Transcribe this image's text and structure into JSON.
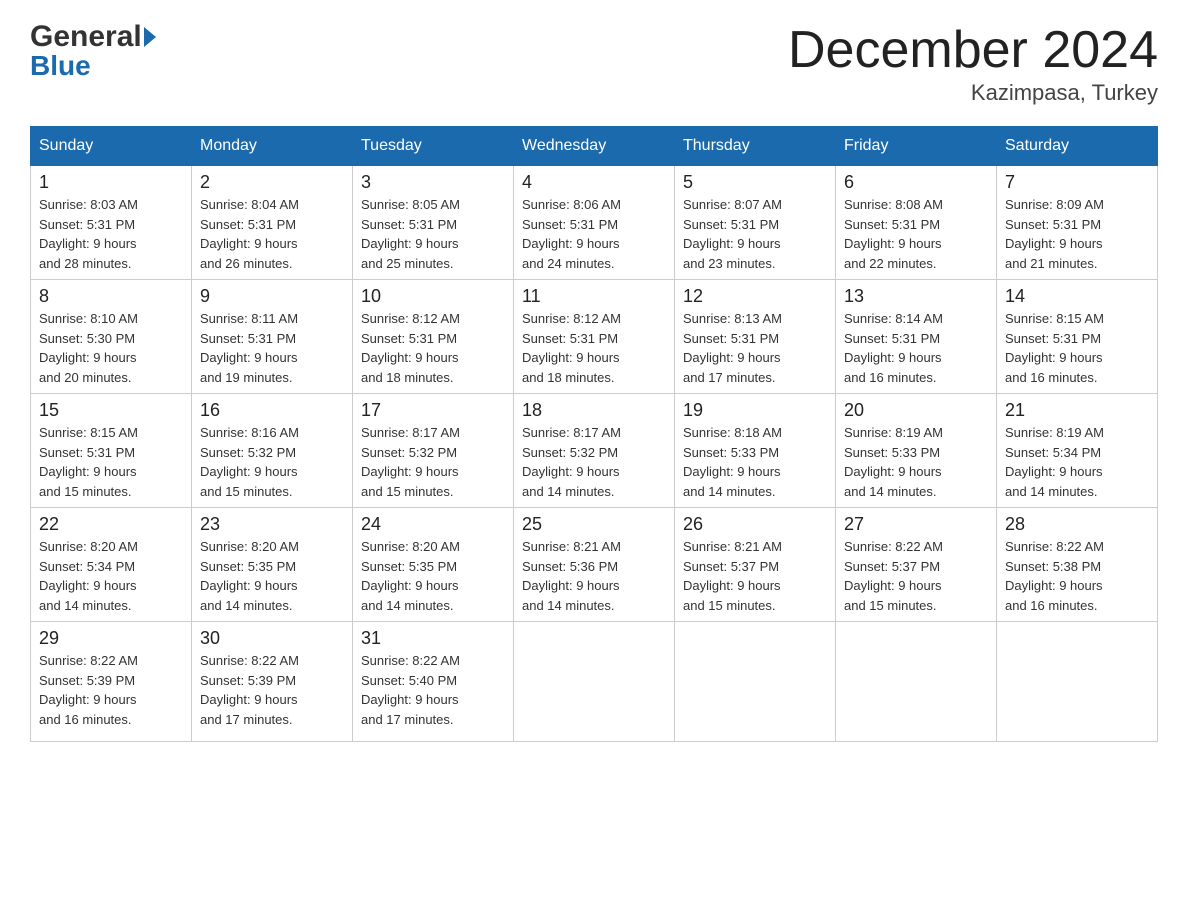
{
  "header": {
    "title": "December 2024",
    "subtitle": "Kazimpasa, Turkey",
    "logo_general": "General",
    "logo_blue": "Blue"
  },
  "days_of_week": [
    "Sunday",
    "Monday",
    "Tuesday",
    "Wednesday",
    "Thursday",
    "Friday",
    "Saturday"
  ],
  "weeks": [
    [
      {
        "day": "1",
        "sunrise": "8:03 AM",
        "sunset": "5:31 PM",
        "daylight": "9 hours and 28 minutes."
      },
      {
        "day": "2",
        "sunrise": "8:04 AM",
        "sunset": "5:31 PM",
        "daylight": "9 hours and 26 minutes."
      },
      {
        "day": "3",
        "sunrise": "8:05 AM",
        "sunset": "5:31 PM",
        "daylight": "9 hours and 25 minutes."
      },
      {
        "day": "4",
        "sunrise": "8:06 AM",
        "sunset": "5:31 PM",
        "daylight": "9 hours and 24 minutes."
      },
      {
        "day": "5",
        "sunrise": "8:07 AM",
        "sunset": "5:31 PM",
        "daylight": "9 hours and 23 minutes."
      },
      {
        "day": "6",
        "sunrise": "8:08 AM",
        "sunset": "5:31 PM",
        "daylight": "9 hours and 22 minutes."
      },
      {
        "day": "7",
        "sunrise": "8:09 AM",
        "sunset": "5:31 PM",
        "daylight": "9 hours and 21 minutes."
      }
    ],
    [
      {
        "day": "8",
        "sunrise": "8:10 AM",
        "sunset": "5:30 PM",
        "daylight": "9 hours and 20 minutes."
      },
      {
        "day": "9",
        "sunrise": "8:11 AM",
        "sunset": "5:31 PM",
        "daylight": "9 hours and 19 minutes."
      },
      {
        "day": "10",
        "sunrise": "8:12 AM",
        "sunset": "5:31 PM",
        "daylight": "9 hours and 18 minutes."
      },
      {
        "day": "11",
        "sunrise": "8:12 AM",
        "sunset": "5:31 PM",
        "daylight": "9 hours and 18 minutes."
      },
      {
        "day": "12",
        "sunrise": "8:13 AM",
        "sunset": "5:31 PM",
        "daylight": "9 hours and 17 minutes."
      },
      {
        "day": "13",
        "sunrise": "8:14 AM",
        "sunset": "5:31 PM",
        "daylight": "9 hours and 16 minutes."
      },
      {
        "day": "14",
        "sunrise": "8:15 AM",
        "sunset": "5:31 PM",
        "daylight": "9 hours and 16 minutes."
      }
    ],
    [
      {
        "day": "15",
        "sunrise": "8:15 AM",
        "sunset": "5:31 PM",
        "daylight": "9 hours and 15 minutes."
      },
      {
        "day": "16",
        "sunrise": "8:16 AM",
        "sunset": "5:32 PM",
        "daylight": "9 hours and 15 minutes."
      },
      {
        "day": "17",
        "sunrise": "8:17 AM",
        "sunset": "5:32 PM",
        "daylight": "9 hours and 15 minutes."
      },
      {
        "day": "18",
        "sunrise": "8:17 AM",
        "sunset": "5:32 PM",
        "daylight": "9 hours and 14 minutes."
      },
      {
        "day": "19",
        "sunrise": "8:18 AM",
        "sunset": "5:33 PM",
        "daylight": "9 hours and 14 minutes."
      },
      {
        "day": "20",
        "sunrise": "8:19 AM",
        "sunset": "5:33 PM",
        "daylight": "9 hours and 14 minutes."
      },
      {
        "day": "21",
        "sunrise": "8:19 AM",
        "sunset": "5:34 PM",
        "daylight": "9 hours and 14 minutes."
      }
    ],
    [
      {
        "day": "22",
        "sunrise": "8:20 AM",
        "sunset": "5:34 PM",
        "daylight": "9 hours and 14 minutes."
      },
      {
        "day": "23",
        "sunrise": "8:20 AM",
        "sunset": "5:35 PM",
        "daylight": "9 hours and 14 minutes."
      },
      {
        "day": "24",
        "sunrise": "8:20 AM",
        "sunset": "5:35 PM",
        "daylight": "9 hours and 14 minutes."
      },
      {
        "day": "25",
        "sunrise": "8:21 AM",
        "sunset": "5:36 PM",
        "daylight": "9 hours and 14 minutes."
      },
      {
        "day": "26",
        "sunrise": "8:21 AM",
        "sunset": "5:37 PM",
        "daylight": "9 hours and 15 minutes."
      },
      {
        "day": "27",
        "sunrise": "8:22 AM",
        "sunset": "5:37 PM",
        "daylight": "9 hours and 15 minutes."
      },
      {
        "day": "28",
        "sunrise": "8:22 AM",
        "sunset": "5:38 PM",
        "daylight": "9 hours and 16 minutes."
      }
    ],
    [
      {
        "day": "29",
        "sunrise": "8:22 AM",
        "sunset": "5:39 PM",
        "daylight": "9 hours and 16 minutes."
      },
      {
        "day": "30",
        "sunrise": "8:22 AM",
        "sunset": "5:39 PM",
        "daylight": "9 hours and 17 minutes."
      },
      {
        "day": "31",
        "sunrise": "8:22 AM",
        "sunset": "5:40 PM",
        "daylight": "9 hours and 17 minutes."
      },
      {
        "day": "",
        "sunrise": "",
        "sunset": "",
        "daylight": ""
      },
      {
        "day": "",
        "sunrise": "",
        "sunset": "",
        "daylight": ""
      },
      {
        "day": "",
        "sunrise": "",
        "sunset": "",
        "daylight": ""
      },
      {
        "day": "",
        "sunrise": "",
        "sunset": "",
        "daylight": ""
      }
    ]
  ],
  "labels": {
    "sunrise": "Sunrise:",
    "sunset": "Sunset:",
    "daylight": "Daylight:"
  }
}
